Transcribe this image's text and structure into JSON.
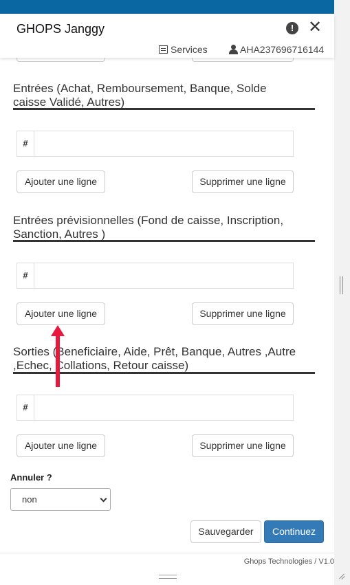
{
  "header": {
    "title": "GHOPS Janggy",
    "warning_glyph": "!",
    "close_glyph": "✕",
    "services_label": "Services",
    "user_id": "AHA237696716144"
  },
  "sections": [
    {
      "title": "Entrées (Achat, Remboursement, Banque, Solde caisse Validé, Autres)",
      "column_header": "#",
      "add_label": "Ajouter une ligne",
      "delete_label": "Supprimer une ligne"
    },
    {
      "title": "Entrées prévisionnelles (Fond de caisse, Inscription, Sanction, Autres )",
      "column_header": "#",
      "add_label": "Ajouter une ligne",
      "delete_label": "Supprimer une ligne"
    },
    {
      "title": "Sorties (Beneficiaire, Aide, Prêt, Banque, Autres ,Autre ,Echec, Collations, Retour caisse)",
      "column_header": "#",
      "add_label": "Ajouter une ligne",
      "delete_label": "Supprimer une ligne"
    }
  ],
  "annuler": {
    "label": "Annuler ?",
    "selected": "non"
  },
  "actions": {
    "save_label": "Sauvegarder",
    "continue_label": "Continuez"
  },
  "footer": {
    "text": "Ghops Technologies / V1.0"
  },
  "colors": {
    "brand_stripe": "#0b67a2",
    "primary_button": "#337ab7",
    "annotation_arrow": "#e8193c"
  },
  "icons": {
    "warning": "exclamation-circle-icon",
    "close": "close-icon",
    "services": "list-icon",
    "user": "user-icon",
    "annotation": "red-arrow-up"
  }
}
